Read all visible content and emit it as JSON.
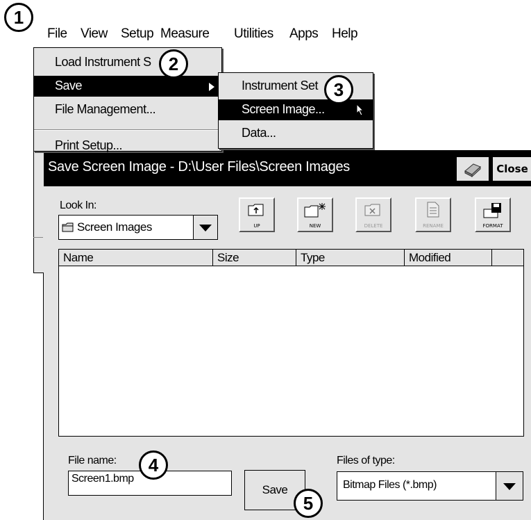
{
  "menubar": {
    "items": [
      "File",
      "View",
      "Setup",
      "Measure",
      "Utilities",
      "Apps",
      "Help"
    ]
  },
  "file_menu": {
    "items": [
      {
        "label": "Load Instrument S",
        "selected": false,
        "submenu": false
      },
      {
        "label": "Save",
        "selected": true,
        "submenu": true
      },
      {
        "label": "File Management...",
        "selected": false,
        "submenu": false
      },
      {
        "label": "Print Setup...",
        "selected": false,
        "submenu": false
      }
    ]
  },
  "save_submenu": {
    "items": [
      {
        "label": "Instrument Set",
        "selected": false
      },
      {
        "label": "Screen Image...",
        "selected": true
      },
      {
        "label": "Data...",
        "selected": false
      }
    ]
  },
  "dialog": {
    "title": "Save Screen Image - D:\\User Files\\Screen Images",
    "close_label": "Close",
    "look_in_label": "Look In:",
    "look_in_value": "Screen Images",
    "toolbar": [
      {
        "caption": "UP",
        "enabled": true,
        "icon": "folder-up-icon"
      },
      {
        "caption": "NEW",
        "enabled": true,
        "icon": "new-folder-icon"
      },
      {
        "caption": "DELETE",
        "enabled": false,
        "icon": "delete-icon"
      },
      {
        "caption": "RENAME",
        "enabled": false,
        "icon": "rename-icon"
      },
      {
        "caption": "FORMAT",
        "enabled": true,
        "icon": "floppy-disk-icon"
      }
    ],
    "columns": [
      "Name",
      "Size",
      "Type",
      "Modified"
    ],
    "file_name_label": "File name:",
    "file_name_value": "Screen1.bmp",
    "save_label": "Save",
    "files_of_type_label": "Files of type:",
    "files_of_type_value": "Bitmap Files (*.bmp)"
  },
  "callouts": [
    "1",
    "2",
    "3",
    "4",
    "5"
  ]
}
